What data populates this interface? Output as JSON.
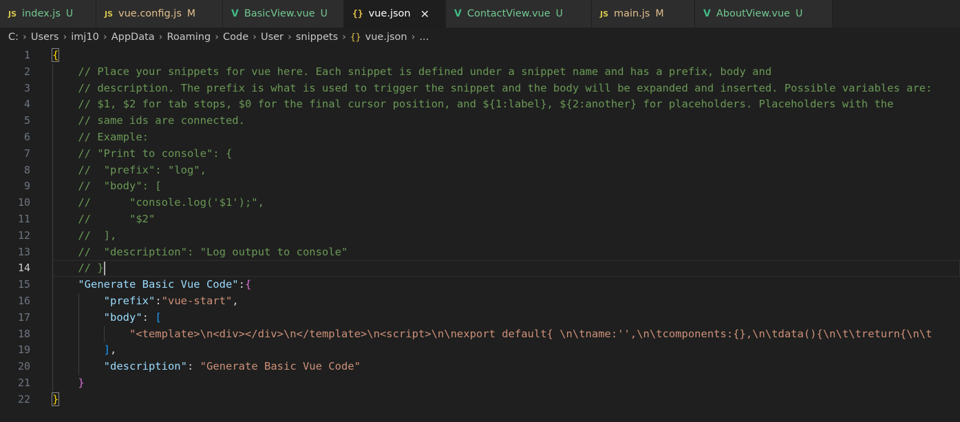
{
  "tabs": [
    {
      "icon": "JS",
      "label": "index.js",
      "status": "U",
      "state": "untracked"
    },
    {
      "icon": "JS",
      "label": "vue.config.js",
      "status": "M",
      "state": "modified"
    },
    {
      "icon": "V",
      "label": "BasicView.vue",
      "status": "U",
      "state": "untracked"
    },
    {
      "icon": "{}",
      "label": "vue.json",
      "status": "",
      "state": "active"
    },
    {
      "icon": "V",
      "label": "ContactView.vue",
      "status": "U",
      "state": "untracked"
    },
    {
      "icon": "JS",
      "label": "main.js",
      "status": "M",
      "state": "modified"
    },
    {
      "icon": "V",
      "label": "AboutView.vue",
      "status": "U",
      "state": "untracked"
    }
  ],
  "tab_close_glyph": "✕",
  "breadcrumb": {
    "segments": [
      "C:",
      "Users",
      "imj10",
      "AppData",
      "Roaming",
      "Code",
      "User",
      "snippets"
    ],
    "file_icon": "{}",
    "file": "vue.json",
    "tail": "..."
  },
  "editor": {
    "active_line": 14,
    "lines": [
      {
        "n": "1",
        "t": "{"
      },
      {
        "n": "2",
        "t": "    // Place your snippets for vue here. Each snippet is defined under a snippet name and has a prefix, body and"
      },
      {
        "n": "3",
        "t": "    // description. The prefix is what is used to trigger the snippet and the body will be expanded and inserted. Possible variables are:"
      },
      {
        "n": "4",
        "t": "    // $1, $2 for tab stops, $0 for the final cursor position, and ${1:label}, ${2:another} for placeholders. Placeholders with the"
      },
      {
        "n": "5",
        "t": "    // same ids are connected."
      },
      {
        "n": "6",
        "t": "    // Example:"
      },
      {
        "n": "7",
        "t": "    // \"Print to console\": {"
      },
      {
        "n": "8",
        "t": "    //  \"prefix\": \"log\","
      },
      {
        "n": "9",
        "t": "    //  \"body\": ["
      },
      {
        "n": "10",
        "t": "    //      \"console.log('$1');\","
      },
      {
        "n": "11",
        "t": "    //      \"$2\""
      },
      {
        "n": "12",
        "t": "    //  ],"
      },
      {
        "n": "13",
        "t": "    //  \"description\": \"Log output to console\""
      },
      {
        "n": "14",
        "t": "    // }"
      },
      {
        "n": "15",
        "t": "    \"Generate Basic Vue Code\":{"
      },
      {
        "n": "16",
        "t": "        \"prefix\":\"vue-start\","
      },
      {
        "n": "17",
        "t": "        \"body\": ["
      },
      {
        "n": "18",
        "t": "            \"<template>\\n<div></div>\\n</template>\\n<script>\\n\\nexport default{ \\n\\tname:'',\\n\\tcomponents:{},\\n\\tdata(){\\n\\t\\treturn{\\n\\t"
      },
      {
        "n": "19",
        "t": "        ],"
      },
      {
        "n": "20",
        "t": "        \"description\": \"Generate Basic Vue Code\""
      },
      {
        "n": "21",
        "t": "    }"
      },
      {
        "n": "22",
        "t": "}"
      }
    ]
  }
}
